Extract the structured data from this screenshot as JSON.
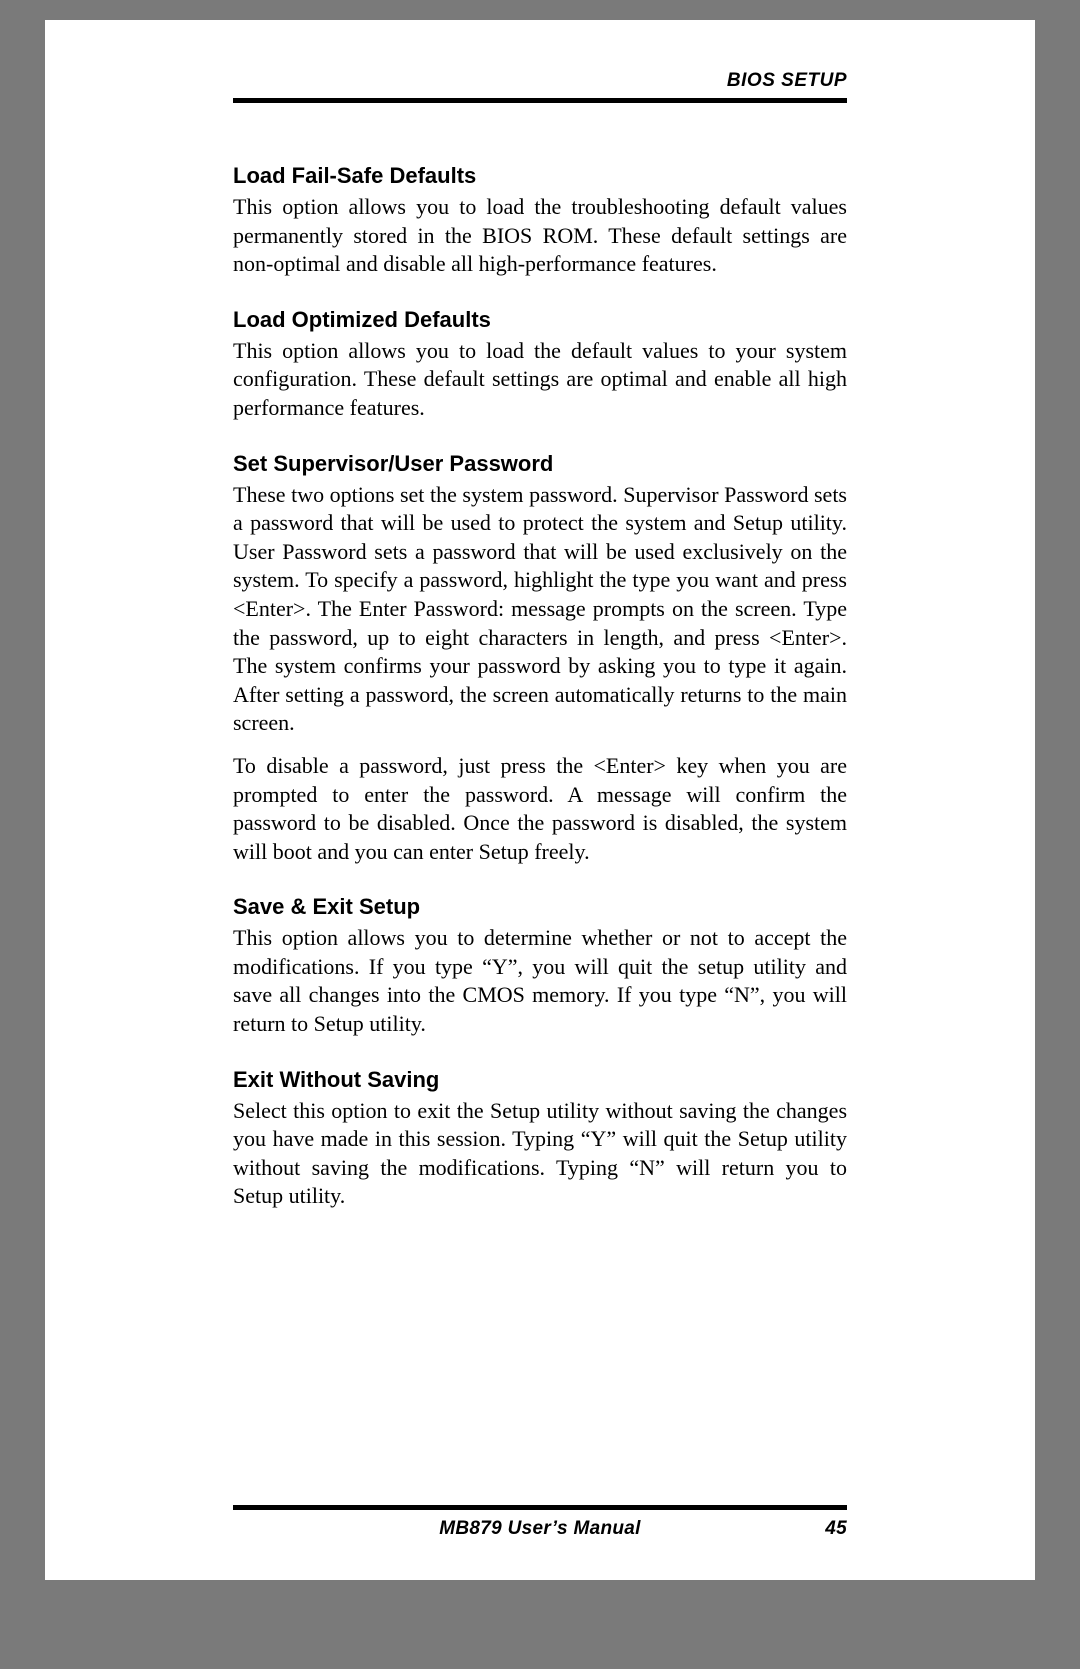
{
  "header": {
    "title": "BIOS SETUP"
  },
  "sections": [
    {
      "heading": "Load Fail-Safe Defaults",
      "paragraphs": [
        "This option allows you to load the troubleshooting default values permanently stored in the BIOS ROM. These default settings are non-optimal and disable all high-performance features."
      ]
    },
    {
      "heading": "Load Optimized Defaults",
      "paragraphs": [
        "This option allows you to load the default values to your system configuration. These default settings are optimal and enable all high performance features."
      ]
    },
    {
      "heading": "Set Supervisor/User Password",
      "paragraphs": [
        "These two options set the system password. Supervisor Password sets a password that will be used to protect the system and Setup utility. User Password sets a password that will be used exclusively on the system. To specify a password, highlight the type you want and press <Enter>. The Enter Password: message prompts on the screen. Type the password, up to eight characters in length, and press <Enter>. The system confirms your password by asking you to type it again. After setting a password, the screen automatically returns to the main screen.",
        "To disable a password, just press the <Enter> key when you are prompted to enter the password. A message will confirm the password to be disabled. Once the password is disabled, the system will boot and you can enter Setup freely."
      ]
    },
    {
      "heading": "Save & Exit Setup",
      "paragraphs": [
        "This option allows you to determine whether or not to accept the modifications. If you type “Y”, you will quit the setup utility and save all changes into the CMOS memory. If you type “N”, you will return to Setup utility."
      ]
    },
    {
      "heading": "Exit Without Saving",
      "paragraphs": [
        "Select this option to exit the Setup utility without saving the changes you have made in this session. Typing “Y” will quit the Setup utility without saving the modifications. Typing “N” will return you to Setup utility."
      ]
    }
  ],
  "footer": {
    "title": "MB879 User’s Manual",
    "page": "45"
  }
}
